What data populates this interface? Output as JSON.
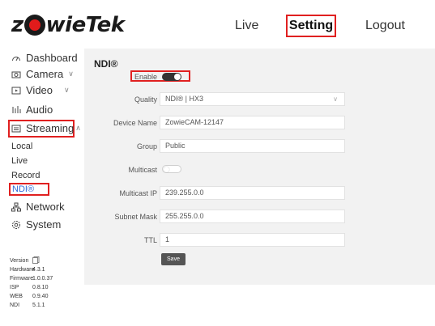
{
  "header": {
    "logo_left": "z",
    "logo_right": "wieTek",
    "nav": {
      "live": "Live",
      "setting": "Setting",
      "logout": "Logout"
    }
  },
  "sidebar": {
    "items": [
      {
        "label": "Dashboard",
        "icon": "dashboard-icon"
      },
      {
        "label": "Camera",
        "icon": "camera-icon",
        "chevron": "∨"
      },
      {
        "label": "Video",
        "icon": "video-icon",
        "chevron": "∨"
      },
      {
        "label": "Audio",
        "icon": "audio-icon"
      },
      {
        "label": "Streaming",
        "icon": "streaming-icon",
        "chevron": "∧"
      },
      {
        "label": "Network",
        "icon": "network-icon"
      },
      {
        "label": "System",
        "icon": "system-icon"
      }
    ],
    "streaming_sub": [
      "Local",
      "Live",
      "Record",
      "NDI®"
    ]
  },
  "version": {
    "title": "Version",
    "rows": [
      {
        "k": "Hardware",
        "v": "4.3.1"
      },
      {
        "k": "Firmware",
        "v": "1.0.0.37"
      },
      {
        "k": "ISP",
        "v": "0.8.10"
      },
      {
        "k": "WEB",
        "v": "0.9.40"
      },
      {
        "k": "NDI",
        "v": "5.1.1"
      }
    ]
  },
  "panel": {
    "title": "NDI®",
    "enable": {
      "label": "Enable",
      "state": "on"
    },
    "quality": {
      "label": "Quality",
      "value": "NDI® | HX3"
    },
    "device_name": {
      "label": "Device Name",
      "value": "ZowieCAM-12147"
    },
    "group": {
      "label": "Group",
      "value": "Public"
    },
    "multicast": {
      "label": "Multicast",
      "state": "off"
    },
    "multicast_ip": {
      "label": "Multicast IP",
      "value": "239.255.0.0"
    },
    "subnet_mask": {
      "label": "Subnet Mask",
      "value": "255.255.0.0"
    },
    "ttl": {
      "label": "TTL",
      "value": "1"
    },
    "save_label": "Save"
  },
  "colors": {
    "highlight": "#e02020",
    "logo_red": "#e21b1b",
    "link_blue": "#2f6ad8"
  }
}
